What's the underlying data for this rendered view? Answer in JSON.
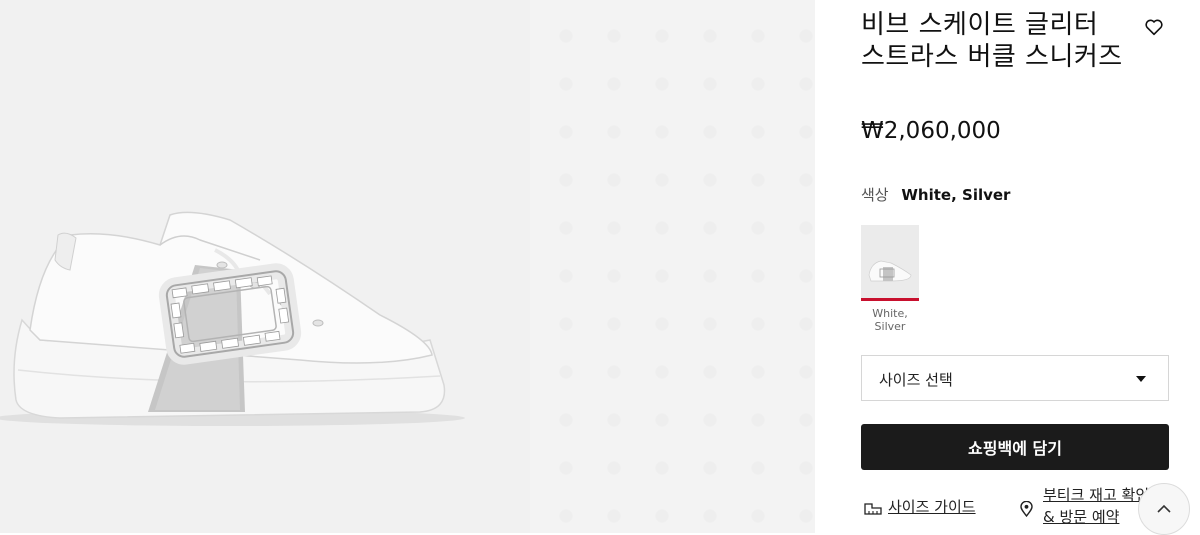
{
  "product": {
    "title": "비브 스케이트 글리터 스트라스 버클 스니커즈",
    "price": "₩2,060,000"
  },
  "color": {
    "label": "색상",
    "value": "White, Silver",
    "swatch_label": "White, Silver"
  },
  "size_select": {
    "placeholder": "사이즈 선택"
  },
  "actions": {
    "add_to_bag": "쇼핑백에 담기",
    "size_guide": "사이즈 가이드",
    "store_check": "부티크 재고 확인 & 방문 예약"
  },
  "icons": {
    "wishlist": "heart-icon",
    "size_guide": "ruler-icon",
    "store": "location-pin-icon",
    "dropdown": "caret-down-icon",
    "scroll_top": "chevron-up-icon"
  },
  "colors": {
    "swatch_selected_underline": "#c8102e",
    "button_bg": "#1b1b1b"
  }
}
